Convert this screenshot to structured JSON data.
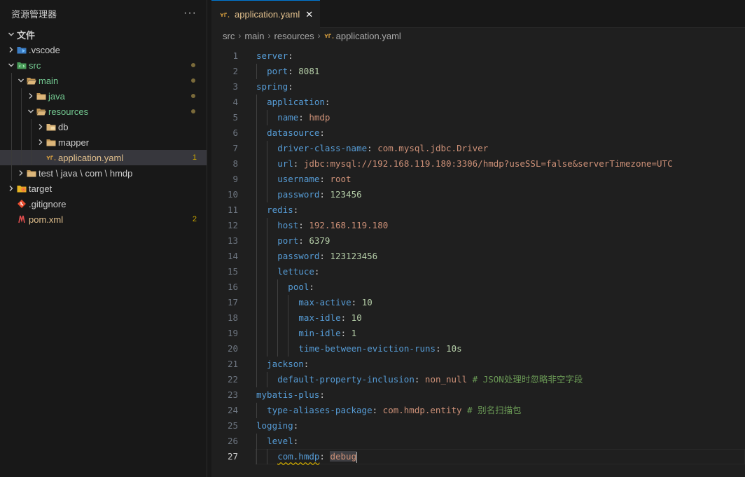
{
  "explorer": {
    "title": "资源管理器",
    "more_icon": "ellipsis-icon",
    "section": "文件",
    "items": [
      {
        "label": ".vscode",
        "icon": "vscode-folder-icon"
      },
      {
        "label": "src",
        "icon": "src-folder-icon"
      },
      {
        "label": "main",
        "icon": "folder-open-icon"
      },
      {
        "label": "java",
        "icon": "folder-icon"
      },
      {
        "label": "resources",
        "icon": "folder-open-icon"
      },
      {
        "label": "db",
        "icon": "db-folder-icon"
      },
      {
        "label": "mapper",
        "icon": "folder-icon"
      },
      {
        "label": "application.yaml",
        "icon": "yaml-icon",
        "badge": "1"
      },
      {
        "label": "test \\ java \\ com \\ hmdp",
        "icon": "folder-icon"
      },
      {
        "label": "target",
        "icon": "target-folder-icon"
      },
      {
        "label": ".gitignore",
        "icon": "git-icon"
      },
      {
        "label": "pom.xml",
        "icon": "maven-icon",
        "badge": "2"
      }
    ]
  },
  "tab": {
    "label": "application.yaml",
    "close_icon": "close-icon"
  },
  "breadcrumb": [
    "src",
    "main",
    "resources",
    "application.yaml"
  ],
  "code": {
    "current_line": 27,
    "lines": [
      {
        "n": "1",
        "indent": 0,
        "key": "server",
        "sep": ":",
        "val": "",
        "vt": "",
        "comment": ""
      },
      {
        "n": "2",
        "indent": 1,
        "key": "port",
        "sep": ": ",
        "val": "8081",
        "vt": "n",
        "comment": ""
      },
      {
        "n": "3",
        "indent": 0,
        "key": "spring",
        "sep": ":",
        "val": "",
        "vt": "",
        "comment": ""
      },
      {
        "n": "4",
        "indent": 1,
        "key": "application",
        "sep": ":",
        "val": "",
        "vt": "",
        "comment": ""
      },
      {
        "n": "5",
        "indent": 2,
        "key": "name",
        "sep": ": ",
        "val": "hmdp",
        "vt": "s",
        "comment": ""
      },
      {
        "n": "6",
        "indent": 1,
        "key": "datasource",
        "sep": ":",
        "val": "",
        "vt": "",
        "comment": ""
      },
      {
        "n": "7",
        "indent": 2,
        "key": "driver-class-name",
        "sep": ": ",
        "val": "com.mysql.jdbc.Driver",
        "vt": "s",
        "comment": ""
      },
      {
        "n": "8",
        "indent": 2,
        "key": "url",
        "sep": ": ",
        "val": "jdbc:mysql://192.168.119.180:3306/hmdp?useSSL=false&serverTimezone=UTC",
        "vt": "s",
        "comment": ""
      },
      {
        "n": "9",
        "indent": 2,
        "key": "username",
        "sep": ": ",
        "val": "root",
        "vt": "s",
        "comment": ""
      },
      {
        "n": "10",
        "indent": 2,
        "key": "password",
        "sep": ": ",
        "val": "123456",
        "vt": "n",
        "comment": ""
      },
      {
        "n": "11",
        "indent": 1,
        "key": "redis",
        "sep": ":",
        "val": "",
        "vt": "",
        "comment": ""
      },
      {
        "n": "12",
        "indent": 2,
        "key": "host",
        "sep": ": ",
        "val": "192.168.119.180",
        "vt": "s",
        "comment": ""
      },
      {
        "n": "13",
        "indent": 2,
        "key": "port",
        "sep": ": ",
        "val": "6379",
        "vt": "n",
        "comment": ""
      },
      {
        "n": "14",
        "indent": 2,
        "key": "password",
        "sep": ": ",
        "val": "123123456",
        "vt": "n",
        "comment": ""
      },
      {
        "n": "15",
        "indent": 2,
        "key": "lettuce",
        "sep": ":",
        "val": "",
        "vt": "",
        "comment": ""
      },
      {
        "n": "16",
        "indent": 3,
        "key": "pool",
        "sep": ":",
        "val": "",
        "vt": "",
        "comment": ""
      },
      {
        "n": "17",
        "indent": 4,
        "key": "max-active",
        "sep": ": ",
        "val": "10",
        "vt": "n",
        "comment": ""
      },
      {
        "n": "18",
        "indent": 4,
        "key": "max-idle",
        "sep": ": ",
        "val": "10",
        "vt": "n",
        "comment": ""
      },
      {
        "n": "19",
        "indent": 4,
        "key": "min-idle",
        "sep": ": ",
        "val": "1",
        "vt": "n",
        "comment": ""
      },
      {
        "n": "20",
        "indent": 4,
        "key": "time-between-eviction-runs",
        "sep": ": ",
        "val": "10s",
        "vt": "n",
        "comment": ""
      },
      {
        "n": "21",
        "indent": 1,
        "key": "jackson",
        "sep": ":",
        "val": "",
        "vt": "",
        "comment": ""
      },
      {
        "n": "22",
        "indent": 2,
        "key": "default-property-inclusion",
        "sep": ": ",
        "val": "non_null",
        "vt": "s",
        "comment": " # JSON处理时忽略非空字段"
      },
      {
        "n": "23",
        "indent": 0,
        "key": "mybatis-plus",
        "sep": ":",
        "val": "",
        "vt": "",
        "comment": ""
      },
      {
        "n": "24",
        "indent": 1,
        "key": "type-aliases-package",
        "sep": ": ",
        "val": "com.hmdp.entity",
        "vt": "s",
        "comment": " # 别名扫描包"
      },
      {
        "n": "25",
        "indent": 0,
        "key": "logging",
        "sep": ":",
        "val": "",
        "vt": "",
        "comment": ""
      },
      {
        "n": "26",
        "indent": 1,
        "key": "level",
        "sep": ":",
        "val": "",
        "vt": "",
        "comment": ""
      },
      {
        "n": "27",
        "indent": 2,
        "key": "com.hmdp",
        "sep": ": ",
        "val": "debug",
        "vt": "s",
        "comment": ""
      }
    ]
  }
}
